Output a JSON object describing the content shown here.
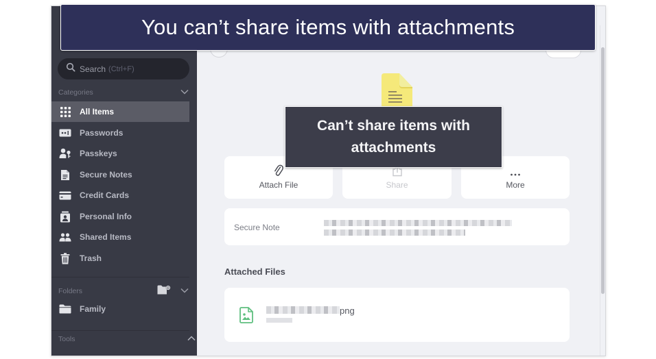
{
  "banner": {
    "text": "You can’t share items with attachments"
  },
  "sidebar": {
    "search": {
      "icon": "search-icon",
      "label": "Search",
      "shortcut": "(Ctrl+F)"
    },
    "categories": {
      "header": "Categories",
      "toggle_icon": "chevron-down-icon",
      "items": [
        {
          "label": "All Items",
          "icon": "grid-icon",
          "active": true
        },
        {
          "label": "Passwords",
          "icon": "password-icon",
          "active": false
        },
        {
          "label": "Passkeys",
          "icon": "passkey-icon",
          "active": false
        },
        {
          "label": "Secure Notes",
          "icon": "note-icon",
          "active": false
        },
        {
          "label": "Credit Cards",
          "icon": "credit-card-icon",
          "active": false
        },
        {
          "label": "Personal Info",
          "icon": "id-badge-icon",
          "active": false
        },
        {
          "label": "Shared Items",
          "icon": "people-icon",
          "active": false
        },
        {
          "label": "Trash",
          "icon": "trash-icon",
          "active": false
        }
      ]
    },
    "folders": {
      "header": "Folders",
      "add_icon": "add-folder-icon",
      "toggle_icon": "chevron-down-icon",
      "items": [
        {
          "label": "Family",
          "icon": "folder-icon"
        }
      ]
    },
    "tools": {
      "header": "Tools",
      "toggle_icon": "chevron-up-icon"
    }
  },
  "main": {
    "item_icon": "secure-note-icon",
    "item_icon_color": "#f5e97a",
    "tooltip": {
      "line1": "Can’t share items with",
      "line2": "attachments"
    },
    "actions": [
      {
        "label": "Attach File",
        "icon": "paperclip-icon",
        "disabled": false
      },
      {
        "label": "Share",
        "icon": "share-icon",
        "disabled": true
      },
      {
        "label": "More",
        "icon": "more-dots-icon",
        "disabled": false
      }
    ],
    "field": {
      "label": "Secure Note",
      "value_redacted": true
    },
    "attached_files": {
      "title": "Attached Files",
      "files": [
        {
          "name_visible_suffix": "png",
          "name_redacted": true,
          "size_redacted": true,
          "icon": "image-file-icon",
          "icon_color": "#5fbf7f"
        }
      ]
    }
  },
  "colors": {
    "banner_bg": "#2e3059",
    "sidebar_bg": "#383a45",
    "sidebar_active_bg": "#5b5c66",
    "main_bg": "#f0f1f5",
    "tooltip_bg": "#3c3d4a"
  }
}
